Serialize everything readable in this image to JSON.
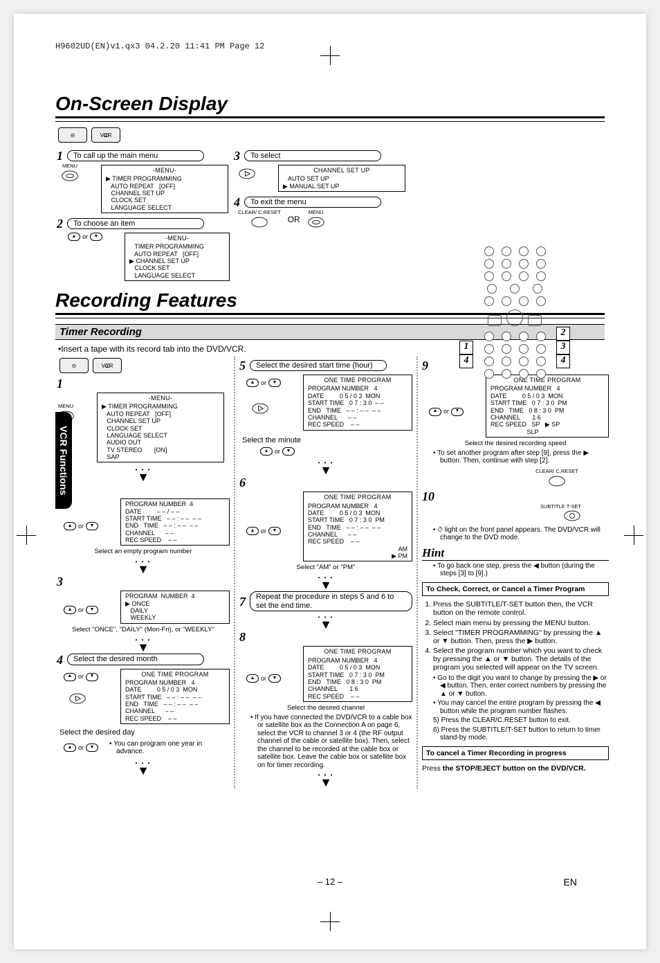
{
  "header": {
    "jobline": "H9602UD(EN)v1.qx3  04.2.20  11:41 PM  Page 12"
  },
  "sideTab": "VCR Functions",
  "labels": {
    "menu": "MENU",
    "or": "or",
    "OR": "OR",
    "clear": "CLEAR/\nC.RESET",
    "subtitle": "SUBTITLE\nT-SET"
  },
  "remote": {
    "c1": "1",
    "c2": "2",
    "c3": "3",
    "c4": "4",
    "c4b": "4"
  },
  "osd": {
    "title": "On-Screen Display",
    "steps": [
      {
        "num": "1",
        "text": "To call up the main menu"
      },
      {
        "num": "2",
        "text": "To choose an item"
      },
      {
        "num": "3",
        "text": "To select"
      },
      {
        "num": "4",
        "text": "To exit the menu"
      }
    ],
    "menuPanel": {
      "title": "-MENU-",
      "l1": "▶ TIMER PROGRAMMING",
      "l2": "   AUTO REPEAT   [OFF]",
      "l3": "   CHANNEL SET UP",
      "l4": "   CLOCK SET",
      "l5": "   LANGUAGE SELECT"
    },
    "menuPanel2": {
      "l1": "   TIMER PROGRAMMING",
      "l2": "   AUTO REPEAT   [OFF]",
      "l3": "▶ CHANNEL SET UP",
      "l4": "   CLOCK SET",
      "l5": "   LANGUAGE SELECT"
    },
    "chPanel": {
      "title": "CHANNEL SET UP",
      "l1": "   AUTO SET UP",
      "l2": "▶ MANUAL SET UP"
    }
  },
  "rec": {
    "title": "Recording Features",
    "subhead": "Timer Recording",
    "insertTape": "•Insert a tape with its record tab into the DVD/VCR.",
    "otp": {
      "title": "ONE TIME PROGRAM"
    },
    "menu1": {
      "l1": "▶ TIMER PROGRAMMING",
      "l2": "   AUTO REPEAT   [OFF]",
      "l3": "   CHANNEL SET UP",
      "l4": "   CLOCK SET",
      "l5": "   LANGUAGE SELECT",
      "l6": "   AUDIO OUT",
      "l7": "   TV STEREO       [ON]",
      "l8": "   SAP"
    },
    "prog2": {
      "l1": "PROGRAM NUMBER  4",
      "l2": "DATE         – – / – –",
      "l3": "START TIME   – – : – –  – –",
      "l4": "END   TIME   – – : – –  – –",
      "l5": "CHANNEL      – –",
      "l6": "REC SPEED    – –"
    },
    "odw": {
      "l0": "PROGRAM  NUMBER  4",
      "l1": "▶ ONCE",
      "l2": "   DAILY",
      "l3": "   WEEKLY"
    },
    "prog4": {
      "l1": "PROGRAM NUMBER   4",
      "l2": "DATE         0 5 / 0 3  MON",
      "l3": "START TIME   – – : – –  – –",
      "l4": "END   TIME   – – : – –  – –",
      "l5": "CHANNEL      – –",
      "l6": "REC SPEED    – –"
    },
    "prog5": {
      "l1": "PROGRAM NUMBER   4",
      "l2": "DATE         0 5 / 0 3  MON",
      "l3": "START TIME   0 7 : 3 0  – –",
      "l4": "END   TIME   – – : – –  – –",
      "l5": "CHANNEL      – –",
      "l6": "REC SPEED    – –"
    },
    "prog6": {
      "l1": "PROGRAM NUMBER   4",
      "l2": "DATE         0 5 / 0 3  MON",
      "l3": "START TIME   0 7 : 3 0  PM",
      "l4": "END   TIME   – – : – –  – –",
      "l5": "CHANNEL      – –",
      "l6": "REC SPEED    – –",
      "l7": "AM\n▶ PM"
    },
    "prog8": {
      "l1": "PROGRAM NUMBER   4",
      "l2": "DATE         0 5 / 0 3  MON",
      "l3": "START TIME   0 7 : 3 0  PM",
      "l4": "END   TIME   0 8 : 3 0  PM",
      "l5": "CHANNEL       1 6",
      "l6": "REC SPEED    – –"
    },
    "prog9": {
      "l1": "PROGRAM NUMBER   4",
      "l2": "DATE         0 5 / 0 3  MON",
      "l3": "START TIME   0 7 : 3 0  PM",
      "l4": "END   TIME   0 8 : 3 0  PM",
      "l5": "CHANNEL       1 6",
      "l6": "REC SPEED   SP   ▶ SP\n                     SLP"
    },
    "steps": [
      {
        "num": "1"
      },
      {
        "num": "2",
        "note": "Select an empty program number"
      },
      {
        "num": "3",
        "note": "Select \"ONCE\", \"DAILY\" (Mon-Fri), or \"WEEKLY\""
      },
      {
        "num": "4",
        "text": "Select the desired month",
        "sub": "Select the desired day",
        "note": "• You can program one year in advance."
      },
      {
        "num": "5",
        "text": "Select the desired start time (hour)",
        "sub": "Select the minute"
      },
      {
        "num": "6",
        "note": "Select \"AM\" or \"PM\""
      },
      {
        "num": "7",
        "text": "Repeat the procedure in steps 5 and 6 to set the end time."
      },
      {
        "num": "8",
        "note": "Select the desired channel",
        "long": "• If you have connected the DVD/VCR to a cable box or satellite box as the Connection A on page 6, select the VCR to channel 3 or 4 (the RF output channel of the cable or satellite box). Then, select the channel to be recorded at the cable box or satellite box. Leave the cable box or satellite box on for timer recording."
      },
      {
        "num": "9",
        "note": "Select the desired recording speed",
        "long": "• To set another program after step [9], press the ▶ button. Then, continue with step [2]."
      },
      {
        "num": "10",
        "long": "• ⏱ light on the front panel appears. The DVD/VCR will change to the DVD mode."
      }
    ],
    "hint": {
      "title": "Hint",
      "body": "• To go back one step, press the ◀ button (during the steps [3] to [9].)"
    },
    "checkbox": {
      "title": "To Check, Correct, or Cancel a Timer Program",
      "items": [
        "Press the SUBTITLE/T-SET button then, the VCR button on the remote control.",
        "Select main menu by pressing the MENU button.",
        "Select \"TIMER PROGRAMMING\" by pressing the ▲ or ▼ button. Then, press the ▶ button.",
        "Select the program number which you want to check by pressing the ▲ or ▼ button. The details of the program you selected will appear on the TV screen.",
        "• Go to the digit you want to change by pressing the ▶ or ◀ button. Then, enter correct numbers by pressing the ▲ or ▼ button.",
        "• You may cancel the entire program by pressing the ◀ button while the program number flashes.",
        "5) Press the CLEAR/C.RESET button to exit.",
        "6) Press the SUBTITLE/T-SET button to return to timer stand-by mode."
      ]
    },
    "cancelbox": {
      "title": "To cancel a Timer Recording in progress",
      "lead": "Press ",
      "bold": "the STOP/EJECT button on the DVD/VCR."
    }
  },
  "footer": {
    "page": "– 12 –",
    "lang": "EN"
  }
}
